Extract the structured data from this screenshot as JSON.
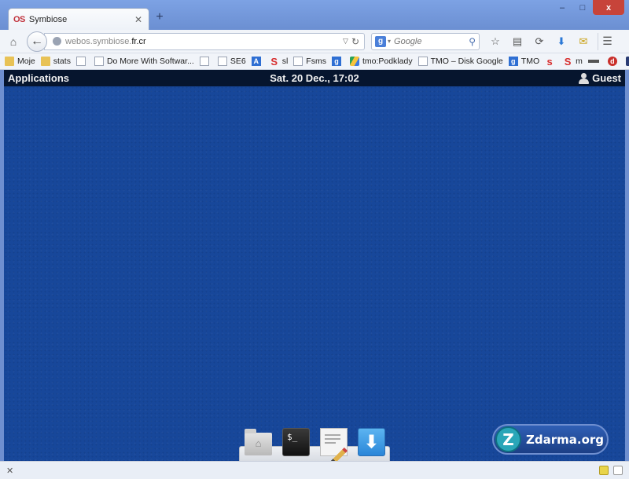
{
  "browser": {
    "tab": {
      "favicon": "OS",
      "title": "Symbiose"
    },
    "new_tab": "+",
    "window_controls": {
      "minimize": "–",
      "maximize": "□",
      "close": "x"
    },
    "url": {
      "host_prefix": "webos.symbiose.",
      "host_domain": "fr.cr"
    },
    "search": {
      "placeholder": "Google",
      "engine": "g"
    },
    "bookmarks": [
      {
        "label": "Moje",
        "icon": "folder-icon"
      },
      {
        "label": "stats",
        "icon": "folder-icon"
      },
      {
        "label": "",
        "icon": "page-icon"
      },
      {
        "label": "Do More With Softwar...",
        "icon": "page-icon"
      },
      {
        "label": "",
        "icon": "page-icon"
      },
      {
        "label": "SE6",
        "icon": "page-icon"
      },
      {
        "label": "",
        "icon": "blue-icon"
      },
      {
        "label": "sl",
        "icon": "s-icon"
      },
      {
        "label": "Fsms",
        "icon": "page-icon"
      },
      {
        "label": "",
        "icon": "blue-icon"
      },
      {
        "label": "tmo:Podklady",
        "icon": "drive-icon"
      },
      {
        "label": "TMO – Disk Google",
        "icon": "page-icon"
      },
      {
        "label": "TMO",
        "icon": "blue-icon"
      },
      {
        "label": "",
        "icon": "s-icon"
      },
      {
        "label": "m",
        "icon": "s-icon"
      }
    ],
    "bookmarks_more": "»"
  },
  "desktop": {
    "panel": {
      "applications": "Applications",
      "clock": "Sat. 20 Dec., 17:02",
      "user": "Guest"
    },
    "dock": {
      "terminal_prompt": "$_",
      "download_arrow": "⬇"
    },
    "watermark": {
      "logo": "Z",
      "text": "Zdarma.org"
    }
  },
  "statusbar": {
    "close": "✕"
  }
}
